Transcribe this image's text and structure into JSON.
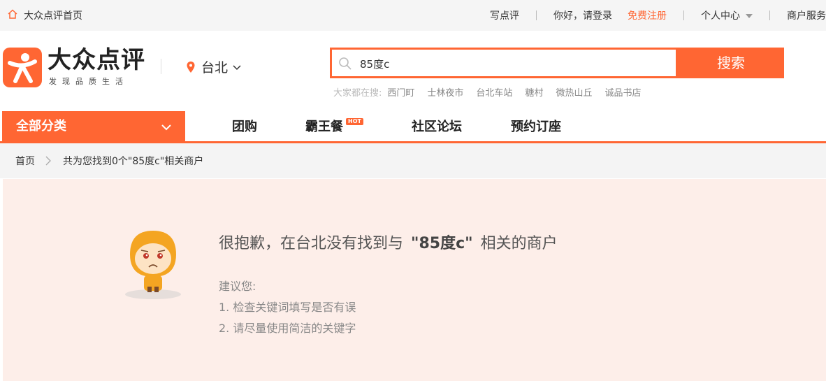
{
  "topbar": {
    "home_link": "大众点评首页",
    "write_review": "写点评",
    "greeting": "你好，请登录",
    "register": "免费注册",
    "user_center": "个人中心",
    "merchant": "商户服务"
  },
  "header": {
    "brand_name": "大众点评",
    "slogan": "发现品质生活",
    "city": "台北"
  },
  "search": {
    "value": "85度c",
    "button": "搜索",
    "hot_label": "大家都在搜:",
    "hot_keywords": [
      "西门町",
      "士林夜市",
      "台北车站",
      "糖村",
      "微热山丘",
      "诚品书店"
    ]
  },
  "nav": {
    "all_categories": "全部分类",
    "items": [
      "团购",
      "霸王餐",
      "社区论坛",
      "预约订座"
    ],
    "hot_badge": "HOT"
  },
  "breadcrumb": {
    "home": "首页",
    "result_info": "共为您找到0个\"85度c\"相关商户"
  },
  "result": {
    "msg_prefix": "很抱歉，在台北没有找到与",
    "msg_keyword": "\"85度c\"",
    "msg_suffix": "相关的商户",
    "suggest_title": "建议您:",
    "suggestions": [
      "1. 检查关键词填写是否有误",
      "2. 请尽量使用简洁的关键字"
    ]
  },
  "colors": {
    "accent": "#ff6633",
    "content_bg": "#fdeee9"
  }
}
